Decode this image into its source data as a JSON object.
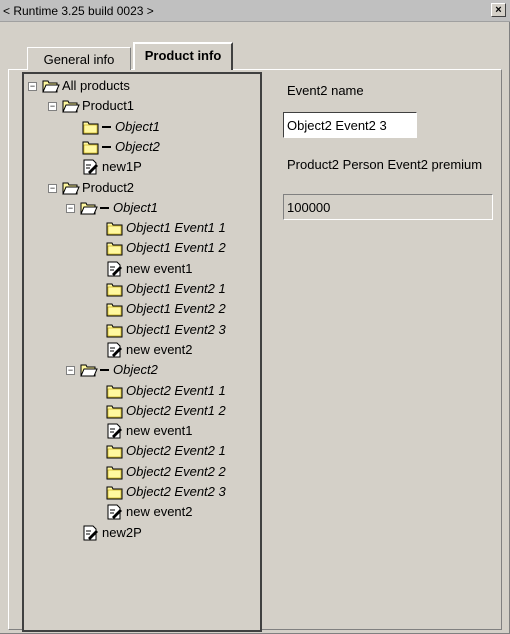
{
  "window": {
    "title": "< Runtime 3.25 build 0023 >",
    "close_label": "×"
  },
  "tabs": [
    {
      "label": "General info",
      "active": false
    },
    {
      "label": "Product info",
      "active": true
    }
  ],
  "tree": [
    {
      "label": "All products",
      "italic": false,
      "depth": 0,
      "icon": "open-folder-icon",
      "expander": "−"
    },
    {
      "label": "Product1",
      "italic": false,
      "depth": 1,
      "icon": "open-folder-icon",
      "expander": "−"
    },
    {
      "label": "Object1",
      "italic": true,
      "depth": 2,
      "icon": "closed-folder-icon",
      "dash": true
    },
    {
      "label": "Object2",
      "italic": true,
      "depth": 2,
      "icon": "closed-folder-icon",
      "dash": true
    },
    {
      "label": "new1P",
      "italic": false,
      "depth": 2,
      "icon": "edit-document-icon"
    },
    {
      "label": "Product2",
      "italic": false,
      "depth": 1,
      "icon": "open-folder-icon",
      "expander": "−"
    },
    {
      "label": "Object1",
      "italic": true,
      "depth": 2,
      "icon": "open-folder-icon",
      "dash": true,
      "expander": "−"
    },
    {
      "label": "Object1 Event1 1",
      "italic": true,
      "depth": 3,
      "icon": "closed-folder-icon"
    },
    {
      "label": "Object1 Event1 2",
      "italic": true,
      "depth": 3,
      "icon": "closed-folder-icon"
    },
    {
      "label": "new event1",
      "italic": false,
      "depth": 3,
      "icon": "edit-document-icon"
    },
    {
      "label": "Object1 Event2 1",
      "italic": true,
      "depth": 3,
      "icon": "closed-folder-icon"
    },
    {
      "label": "Object1 Event2 2",
      "italic": true,
      "depth": 3,
      "icon": "closed-folder-icon"
    },
    {
      "label": "Object1 Event2 3",
      "italic": true,
      "depth": 3,
      "icon": "closed-folder-icon"
    },
    {
      "label": "new event2",
      "italic": false,
      "depth": 3,
      "icon": "edit-document-icon"
    },
    {
      "label": "Object2",
      "italic": true,
      "depth": 2,
      "icon": "open-folder-icon",
      "dash": true,
      "expander": "−"
    },
    {
      "label": "Object2 Event1 1",
      "italic": true,
      "depth": 3,
      "icon": "closed-folder-icon"
    },
    {
      "label": "Object2 Event1 2",
      "italic": true,
      "depth": 3,
      "icon": "closed-folder-icon"
    },
    {
      "label": "new event1",
      "italic": false,
      "depth": 3,
      "icon": "edit-document-icon"
    },
    {
      "label": "Object2 Event2 1",
      "italic": true,
      "depth": 3,
      "icon": "closed-folder-icon"
    },
    {
      "label": "Object2 Event2 2",
      "italic": true,
      "depth": 3,
      "icon": "closed-folder-icon"
    },
    {
      "label": "Object2 Event2 3",
      "italic": true,
      "depth": 3,
      "icon": "closed-folder-icon"
    },
    {
      "label": "new event2",
      "italic": false,
      "depth": 3,
      "icon": "edit-document-icon"
    },
    {
      "label": "new2P",
      "italic": false,
      "depth": 2,
      "icon": "edit-document-icon"
    }
  ],
  "detail": {
    "name_label": "Event2 name",
    "name_value": "Object2 Event2 3",
    "premium_label": "Product2 Person Event2 premium",
    "premium_value": "100000"
  },
  "colors": {
    "folder_yellow": "#fff8a0",
    "window_bg": "#d4d0c8"
  }
}
